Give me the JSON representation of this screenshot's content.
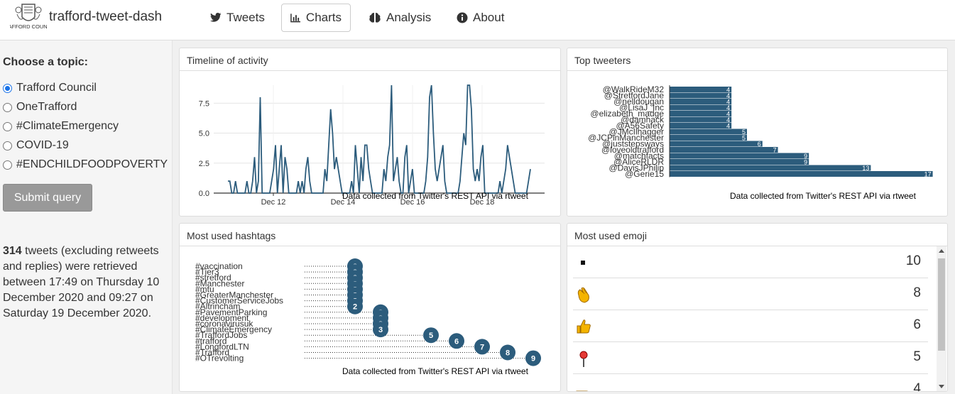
{
  "app": {
    "brand": "trafford-tweet-dash",
    "logo_text": "TRAFFORD COUNCIL"
  },
  "nav": [
    {
      "label": "Tweets",
      "icon": "twitter-icon"
    },
    {
      "label": "Charts",
      "icon": "bar-chart-icon",
      "active": true
    },
    {
      "label": "Analysis",
      "icon": "brain-icon"
    },
    {
      "label": "About",
      "icon": "info-icon"
    }
  ],
  "sidebar": {
    "title": "Choose a topic:",
    "topics": [
      "Trafford Council",
      "OneTrafford",
      "#ClimateEmergency",
      "COVID-19",
      "#ENDCHILDFOODPOVERTY"
    ],
    "selected": "Trafford Council",
    "submit_label": "Submit query",
    "summary_count": "314",
    "summary_text": " tweets (excluding retweets and replies) were retrieved between 17:49 on Thursday 10 December 2020 and 09:27 on Saturday 19 December 2020."
  },
  "panels": {
    "timeline": {
      "title": "Timeline of activity",
      "caption": "Data collected from Twitter's REST API via rtweet"
    },
    "top_tweeters": {
      "title": "Top tweeters",
      "caption": "Data collected from Twitter's REST API via rtweet"
    },
    "hashtags": {
      "title": "Most used hashtags",
      "caption": "Data collected from Twitter's REST API via rtweet"
    },
    "emoji": {
      "title": "Most used emoji"
    }
  },
  "emoji_list": [
    {
      "icon": "small-square-icon",
      "count": "10"
    },
    {
      "icon": "clapping-hands-icon",
      "count": "8"
    },
    {
      "icon": "thumbs-up-icon",
      "count": "6"
    },
    {
      "icon": "round-pushpin-icon",
      "count": "5"
    },
    {
      "icon": "pointing-hand-icon",
      "count": "4"
    }
  ],
  "colors": {
    "bar": "#2c5c7c",
    "accent": "#1a73e8",
    "button": "#999999"
  },
  "chart_data": [
    {
      "type": "line",
      "title": "Timeline of activity",
      "x_tick_labels": [
        "Dec 12",
        "Dec 14",
        "Dec 16",
        "Dec 18"
      ],
      "y_ticks": [
        "0.0",
        "2.5",
        "5.0",
        "7.5"
      ],
      "ylim": [
        0,
        9
      ],
      "grid": true,
      "values": [
        1,
        1,
        0,
        0,
        1,
        0,
        0,
        0,
        0,
        0,
        1,
        0,
        0,
        1,
        3,
        0,
        1,
        8,
        0,
        0,
        0,
        0,
        0,
        1,
        2,
        4,
        0,
        2,
        4,
        0,
        3,
        2,
        0,
        0,
        0,
        0,
        0,
        1,
        0,
        1,
        0,
        2,
        3,
        1,
        0,
        0,
        0,
        0,
        0,
        0,
        0,
        2,
        1,
        4,
        7,
        5,
        2,
        3,
        2,
        1,
        0,
        0,
        0,
        0,
        0,
        1,
        0,
        4,
        2,
        0,
        3,
        1,
        4,
        4,
        2,
        1,
        0,
        0,
        0,
        0,
        0,
        0,
        2,
        1,
        3,
        4,
        9,
        1,
        2,
        3,
        1,
        0,
        0,
        3,
        4,
        0,
        1,
        2,
        0,
        0,
        0,
        0,
        0,
        0,
        1,
        3,
        8,
        9,
        5,
        2,
        1,
        2,
        3,
        4,
        1,
        0,
        0,
        0,
        0,
        0,
        0,
        0,
        1,
        3,
        5,
        4,
        9,
        9,
        7,
        2,
        1,
        2,
        1,
        3,
        4,
        0,
        0,
        0,
        0,
        0,
        0,
        0,
        0,
        1,
        0,
        1,
        2,
        4,
        3,
        2,
        1,
        0,
        0,
        0,
        0,
        0,
        0,
        0,
        1,
        2
      ]
    },
    {
      "type": "bar",
      "title": "Top tweeters",
      "orientation": "horizontal",
      "categories": [
        "@WalkRideM32",
        "@StretfordJane",
        "@nelldougan",
        "@LisaJ_Inc",
        "@elizabeth_madge",
        "@damhack",
        "@A56Safety",
        "@JMcIlhagger",
        "@JCPinManchester",
        "@juststepsways",
        "@loveoldtrafford",
        "@matchfacts",
        "@AliceRLDR",
        "@DavisJPhilip",
        "@Gerie15"
      ],
      "values": [
        4,
        4,
        4,
        4,
        4,
        4,
        4,
        5,
        5,
        6,
        7,
        9,
        9,
        13,
        17
      ]
    },
    {
      "type": "scatter",
      "title": "Most used hashtags",
      "categories": [
        "#vaccination",
        "#Tier3",
        "#stretford",
        "#Manchester",
        "#mtu",
        "#GreaterManchester",
        "#CustomerServiceJobs",
        "#Altrincham",
        "#PavementParking",
        "#development",
        "#coronavirusuk",
        "#ClimateEmergency",
        "#TraffordJobs",
        "#trafford",
        "#LongfordLTN",
        "#Trafford",
        "#OTrevolting"
      ],
      "values": [
        2,
        2,
        2,
        2,
        2,
        2,
        2,
        2,
        3,
        3,
        3,
        3,
        5,
        6,
        7,
        8,
        9
      ]
    }
  ]
}
